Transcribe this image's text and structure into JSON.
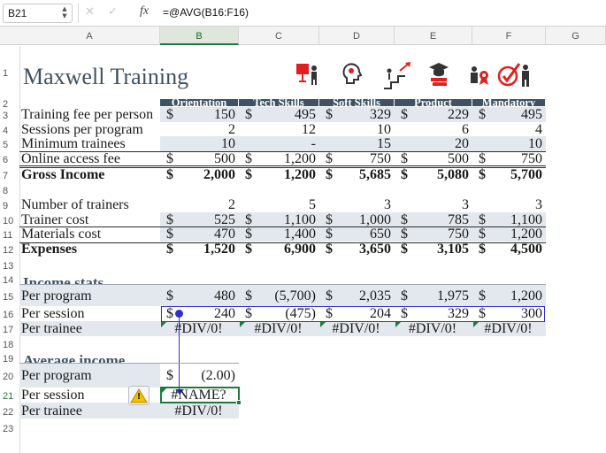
{
  "formula_bar": {
    "cell_ref": "B21",
    "formula": "=@AVG(B16:F16)",
    "fx_label": "fx",
    "cancel_glyph": "✕",
    "confirm_glyph": "✓"
  },
  "columns": [
    "A",
    "B",
    "C",
    "D",
    "E",
    "F",
    "G"
  ],
  "rows": [
    "1",
    "2",
    "3",
    "4",
    "5",
    "6",
    "7",
    "8",
    "9",
    "10",
    "11",
    "12",
    "13",
    "14",
    "15",
    "16",
    "17",
    "18",
    "19",
    "20",
    "21",
    "22",
    "23"
  ],
  "title": "Maxwell Training",
  "header_icons": [
    "presenter-icon",
    "idea-head-icon",
    "career-stairs-icon",
    "graduation-books-icon",
    "award-person-icon",
    "checkmark-person-icon"
  ],
  "program_headers": [
    "Orientation",
    "Tech Skills",
    "Soft Skills",
    "Product",
    "Mandatory"
  ],
  "section1": [
    {
      "label": "Training fee per person",
      "cur": true,
      "values": [
        "150",
        "495",
        "329",
        "229",
        "495"
      ]
    },
    {
      "label": "Sessions per program",
      "cur": false,
      "values": [
        "2",
        "12",
        "10",
        "6",
        "4"
      ]
    },
    {
      "label": "Minimum trainees",
      "cur": false,
      "values": [
        "10",
        "-",
        "15",
        "20",
        "10"
      ]
    },
    {
      "label": "Online access fee",
      "cur": true,
      "values": [
        "500",
        "1,200",
        "750",
        "500",
        "750"
      ]
    },
    {
      "label": "Gross Income",
      "cur": true,
      "values": [
        "2,000",
        "1,200",
        "5,685",
        "5,080",
        "5,700"
      ]
    }
  ],
  "section2": [
    {
      "label": "Number of trainers",
      "cur": false,
      "values": [
        "2",
        "5",
        "3",
        "3",
        "3"
      ]
    },
    {
      "label": "Trainer cost",
      "cur": true,
      "values": [
        "525",
        "1,100",
        "1,000",
        "785",
        "1,100"
      ]
    },
    {
      "label": "Materials cost",
      "cur": true,
      "values": [
        "470",
        "1,400",
        "650",
        "750",
        "1,200"
      ]
    },
    {
      "label": "Expenses",
      "cur": true,
      "values": [
        "1,520",
        "6,900",
        "3,650",
        "3,105",
        "4,500"
      ]
    }
  ],
  "income_stats": {
    "heading": "Income stats",
    "rows": [
      {
        "label": "Per program",
        "cur": true,
        "values": [
          "480",
          "(5,700)",
          "2,035",
          "1,975",
          "1,200"
        ]
      },
      {
        "label": "Per session",
        "cur": true,
        "values": [
          "240",
          "(475)",
          "204",
          "329",
          "300"
        ]
      },
      {
        "label": "Per trainee",
        "cur": false,
        "values": [
          "#DIV/0!",
          "#DIV/0!",
          "#DIV/0!",
          "#DIV/0!",
          "#DIV/0!"
        ]
      }
    ]
  },
  "average_income": {
    "heading": "Average income",
    "rows": [
      {
        "label": "Per program",
        "cur": "$",
        "value": "(2.00)"
      },
      {
        "label": "Per session",
        "value": "#NAME?"
      },
      {
        "label": "Per trainee",
        "value": "#DIV/0!"
      }
    ]
  },
  "currency_symbol": "$",
  "warning_glyph": "!",
  "colors": {
    "header_bg": "#3e5263",
    "band_bg": "#e2e8ee",
    "title": "#3e5263",
    "select_green": "#1e7a3c",
    "trace_blue": "#2f2fd0",
    "icon_red": "#e02020"
  }
}
